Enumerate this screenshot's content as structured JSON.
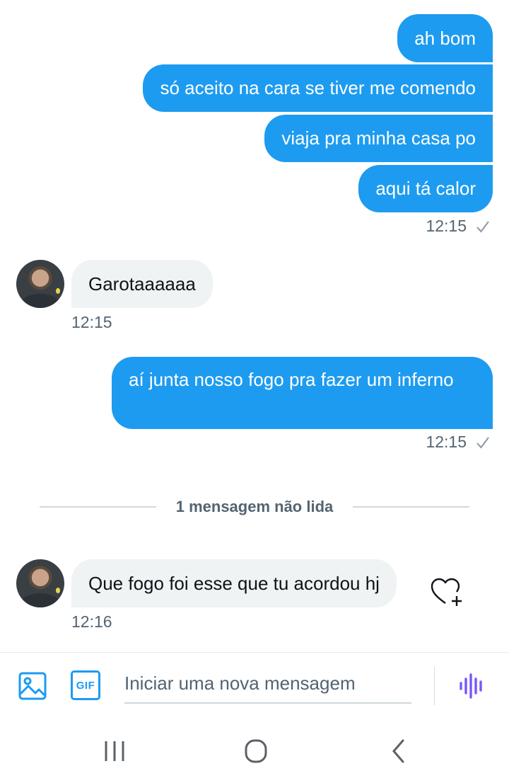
{
  "messages": [
    {
      "text": "ah bom"
    },
    {
      "text": "só aceito na cara se tiver me comendo"
    },
    {
      "text": "viaja pra minha casa po"
    },
    {
      "text": "aqui tá calor"
    },
    {
      "text": "Garotaaaaaa"
    },
    {
      "text": "aí junta nosso fogo pra fazer um inferno"
    },
    {
      "text": "Que fogo foi esse que tu acordou hj"
    }
  ],
  "timestamps": {
    "group1": "12:15",
    "incoming1": "12:15",
    "outgoing2": "12:15",
    "incoming2": "12:16"
  },
  "divider": {
    "label": "1 mensagem não lida"
  },
  "composer": {
    "placeholder": "Iniciar uma nova mensagem",
    "gif_label": "GIF"
  },
  "colors": {
    "accent": "#1d9bf0",
    "incoming_bubble": "#eff3f4",
    "voice": "#7856ff"
  },
  "icons": [
    "check-icon",
    "heart-plus-icon",
    "image-icon",
    "gif-icon",
    "voice-wave-icon",
    "recent-apps-icon",
    "home-icon",
    "back-icon"
  ]
}
